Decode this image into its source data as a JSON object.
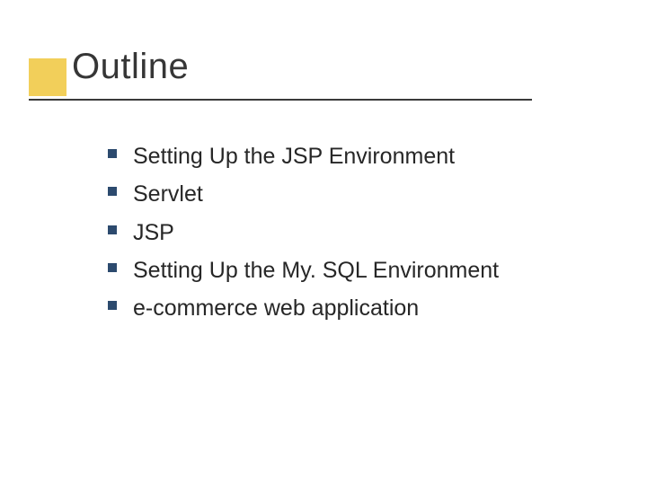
{
  "slide": {
    "title": "Outline",
    "bullets": [
      "Setting Up the JSP Environment",
      "Servlet",
      "JSP",
      "Setting Up the My. SQL Environment",
      "e-commerce web application"
    ]
  }
}
